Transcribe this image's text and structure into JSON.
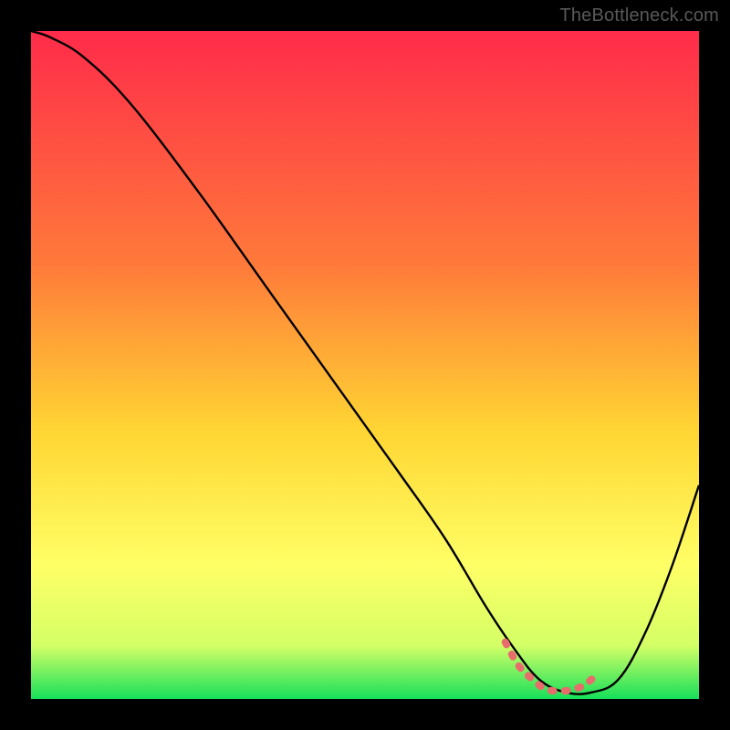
{
  "credit": "TheBottleneck.com",
  "colors": {
    "top": "#ff2b4a",
    "mid1": "#ff7a3a",
    "mid2": "#ffd633",
    "mid3": "#ffff66",
    "mid4": "#d4ff66",
    "bottom": "#16e05a",
    "curve": "#000000",
    "highlight": "#e86c6c"
  },
  "chart_data": {
    "type": "line",
    "title": "",
    "xlabel": "",
    "ylabel": "",
    "xlim": [
      0,
      100
    ],
    "ylim": [
      0,
      100
    ],
    "series": [
      {
        "name": "bottleneck-curve",
        "x": [
          0,
          3,
          8,
          15,
          25,
          35,
          45,
          55,
          62,
          68,
          72,
          76,
          80,
          84,
          88,
          92,
          96,
          100
        ],
        "y": [
          100,
          99,
          96,
          89,
          76,
          62,
          48,
          34,
          24,
          14,
          8,
          3,
          1,
          1,
          3,
          10,
          20,
          32
        ]
      }
    ],
    "highlight_segment": {
      "name": "optimal-range",
      "x": [
        71,
        73,
        75,
        77,
        79,
        81,
        83,
        85
      ],
      "y": [
        8.5,
        5,
        3,
        1.5,
        1.2,
        1.4,
        2.2,
        4
      ]
    }
  }
}
